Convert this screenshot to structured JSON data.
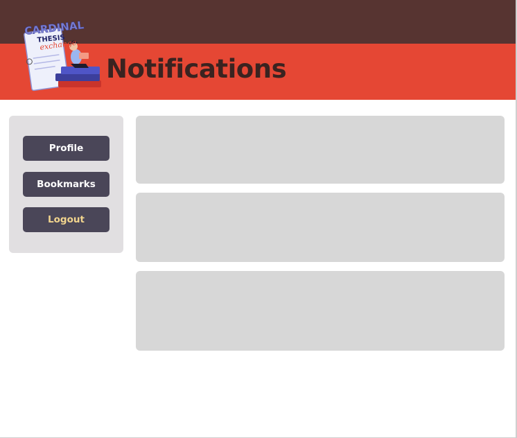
{
  "header": {
    "title": "Notifications",
    "logo_text": [
      "CARDINAL",
      "THESIS",
      "exchange"
    ]
  },
  "sidebar": {
    "items": [
      {
        "label": "Profile"
      },
      {
        "label": "Bookmarks"
      },
      {
        "label": "Logout"
      }
    ]
  },
  "notifications": [
    {
      "text": ""
    },
    {
      "text": ""
    },
    {
      "text": ""
    }
  ],
  "colors": {
    "top_band": "#573431",
    "header_red": "#e54734",
    "sidebar_bg": "#e1dfe1",
    "button_bg": "#4a4658",
    "logout_text": "#f2d58e",
    "card_bg": "#d7d7d7"
  }
}
